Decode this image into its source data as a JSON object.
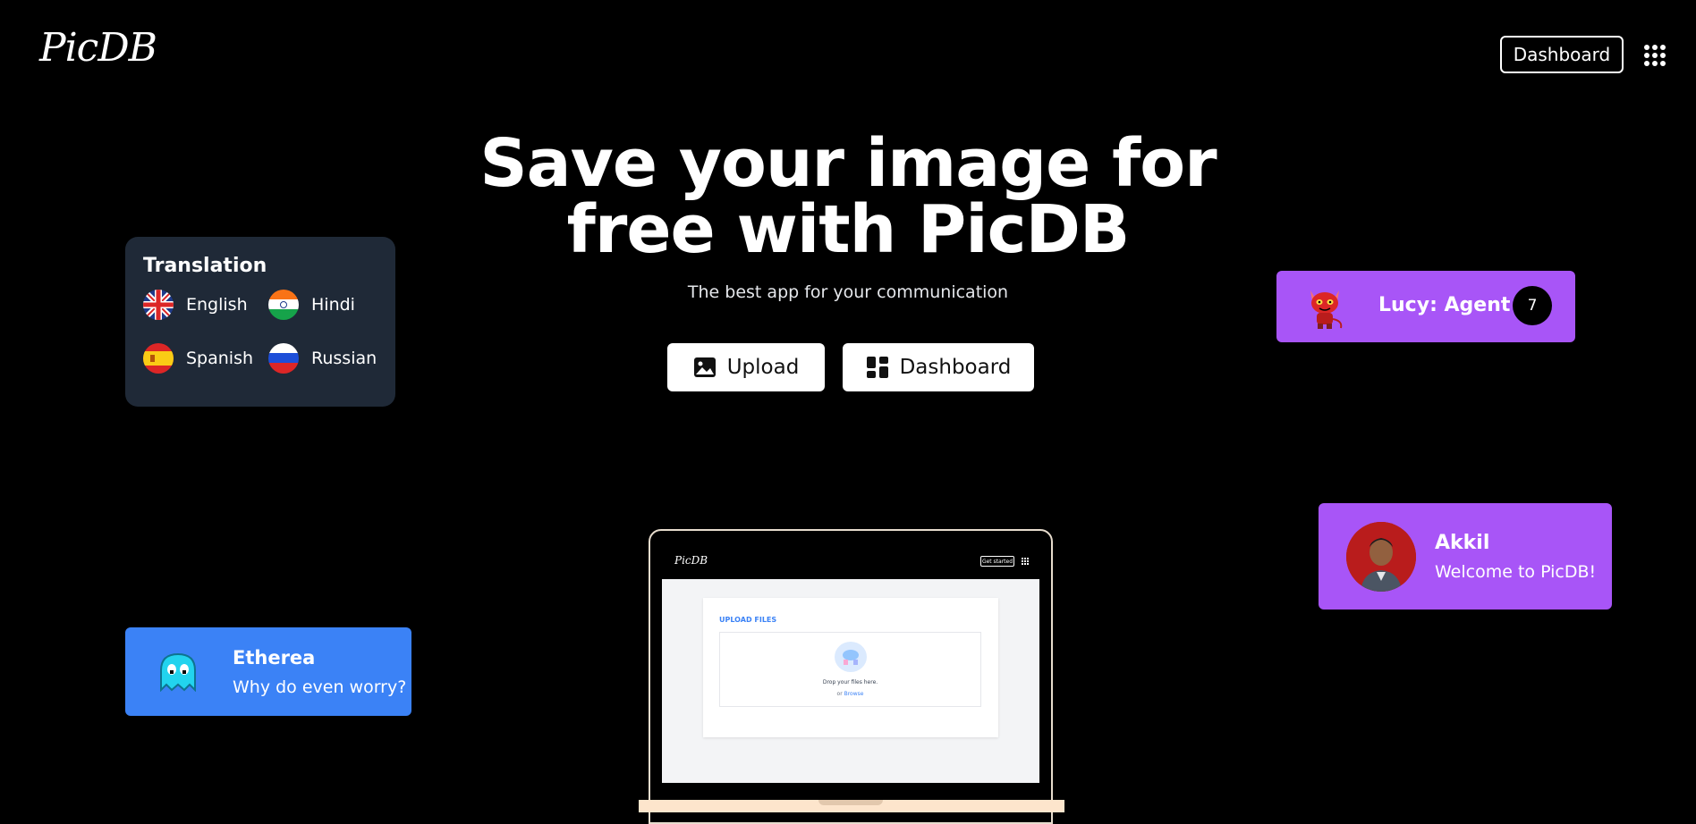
{
  "header": {
    "logo": "PicDB",
    "dashboard_label": "Dashboard",
    "apps_icon": "grid-icon"
  },
  "hero": {
    "title_line1": "Save your image for",
    "title_line2": "free with PicDB",
    "subtitle": "The best app for your communication",
    "upload_label": "Upload",
    "dashboard_label": "Dashboard"
  },
  "translation": {
    "title": "Translation",
    "languages": [
      {
        "label": "English",
        "flag": "uk-flag-icon"
      },
      {
        "label": "Hindi",
        "flag": "india-flag-icon"
      },
      {
        "label": "Spanish",
        "flag": "spain-flag-icon"
      },
      {
        "label": "Russian",
        "flag": "russia-flag-icon"
      }
    ]
  },
  "lucy_card": {
    "name": "Lucy: Agent",
    "count": "7",
    "color": "#a855f7"
  },
  "akkil_card": {
    "name": "Akkil",
    "message": "Welcome to PicDB!",
    "color": "#a855f7"
  },
  "etherea_card": {
    "name": "Etherea",
    "message": "Why do even worry?",
    "color": "#3b82f6"
  },
  "laptop_preview": {
    "logo": "PicDB",
    "button_label": "Get started",
    "upload_title": "UPLOAD FILES",
    "drop_text": "Drop your files here.",
    "browse_prefix": "or",
    "browse_link": "Browse"
  }
}
